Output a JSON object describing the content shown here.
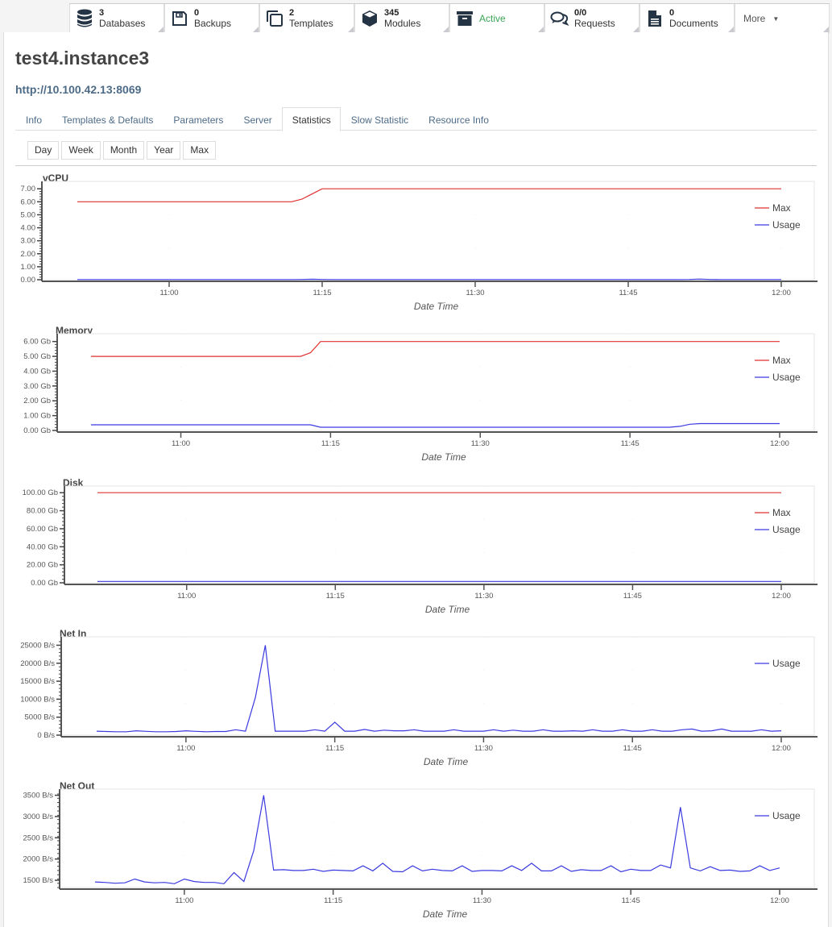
{
  "topbar": {
    "items": [
      {
        "icon": "database-icon",
        "count": "3",
        "label": "Databases"
      },
      {
        "icon": "floppy-disk-icon",
        "count": "0",
        "label": "Backups"
      },
      {
        "icon": "copy-icon",
        "count": "2",
        "label": "Templates"
      },
      {
        "icon": "cube-icon",
        "count": "345",
        "label": "Modules"
      },
      {
        "icon": "archive-icon",
        "status": "Active",
        "status_color": "#3aa655"
      },
      {
        "icon": "comments-icon",
        "count": "0/0",
        "label": "Requests"
      },
      {
        "icon": "file-icon",
        "count": "0",
        "label": "Documents"
      }
    ],
    "more_label": "More"
  },
  "instance": {
    "title": "test4.instance3",
    "url": "http://10.100.42.13:8069"
  },
  "tabs": [
    {
      "label": "Info"
    },
    {
      "label": "Templates & Defaults"
    },
    {
      "label": "Parameters"
    },
    {
      "label": "Server"
    },
    {
      "label": "Statistics",
      "active": true
    },
    {
      "label": "Slow Statistic"
    },
    {
      "label": "Resource Info"
    }
  ],
  "periods": [
    "Day",
    "Week",
    "Month",
    "Year",
    "Max"
  ],
  "colors": {
    "max": "#e03030",
    "usage": "#3a3ae0"
  },
  "chart_data": [
    {
      "type": "line",
      "title": "vCPU",
      "xlabel": "Date Time",
      "ylabel": "",
      "x_start": "10:51",
      "x_end": "12:00",
      "x_step_minutes": 1,
      "xticks": [
        "11:00",
        "11:15",
        "11:30",
        "11:45",
        "12:00"
      ],
      "yticks": [
        "0.00",
        "1.00",
        "2.00",
        "3.00",
        "4.00",
        "5.00",
        "6.00",
        "7.00"
      ],
      "ylim": [
        0,
        7.2
      ],
      "legend": "top-right",
      "series": [
        {
          "name": "Max",
          "color_key": "max",
          "values": [
            6,
            6,
            6,
            6,
            6,
            6,
            6,
            6,
            6,
            6,
            6,
            6,
            6,
            6,
            6,
            6,
            6,
            6,
            6,
            6,
            6,
            6,
            6.2,
            6.6,
            7,
            7,
            7,
            7,
            7,
            7,
            7,
            7,
            7,
            7,
            7,
            7,
            7,
            7,
            7,
            7,
            7,
            7,
            7,
            7,
            7,
            7,
            7,
            7,
            7,
            7,
            7,
            7,
            7,
            7,
            7,
            7,
            7,
            7,
            7,
            7,
            7,
            7,
            7,
            7,
            7,
            7,
            7,
            7,
            7,
            7
          ]
        },
        {
          "name": "Usage",
          "color_key": "usage",
          "values": [
            0.01,
            0.01,
            0.01,
            0.01,
            0.01,
            0.01,
            0.01,
            0.01,
            0.01,
            0.01,
            0.01,
            0.01,
            0.01,
            0.01,
            0.01,
            0.01,
            0.01,
            0.01,
            0.01,
            0.01,
            0.01,
            0.01,
            0.02,
            0.04,
            0.02,
            0.01,
            0.01,
            0.01,
            0.01,
            0.01,
            0.01,
            0.01,
            0.01,
            0.01,
            0.01,
            0.01,
            0.01,
            0.01,
            0.01,
            0.01,
            0.01,
            0.01,
            0.01,
            0.01,
            0.01,
            0.01,
            0.01,
            0.01,
            0.01,
            0.01,
            0.01,
            0.01,
            0.01,
            0.01,
            0.01,
            0.01,
            0.01,
            0.01,
            0.01,
            0.01,
            0.02,
            0.05,
            0.02,
            0.01,
            0.01,
            0.01,
            0.01,
            0.01,
            0.01,
            0.01
          ]
        }
      ]
    },
    {
      "type": "line",
      "title": "Memory",
      "xlabel": "Date Time",
      "ylabel": "",
      "x_start": "10:51",
      "x_end": "12:00",
      "x_step_minutes": 1,
      "xticks": [
        "11:00",
        "11:15",
        "11:30",
        "11:45",
        "12:00"
      ],
      "yticks": [
        "0.00 Gb",
        "1.00 Gb",
        "2.00 Gb",
        "3.00 Gb",
        "4.00 Gb",
        "5.00 Gb",
        "6.00 Gb"
      ],
      "ylim": [
        0,
        6.2
      ],
      "legend": "top-right",
      "series": [
        {
          "name": "Max",
          "color_key": "max",
          "values": [
            5,
            5,
            5,
            5,
            5,
            5,
            5,
            5,
            5,
            5,
            5,
            5,
            5,
            5,
            5,
            5,
            5,
            5,
            5,
            5,
            5,
            5,
            5.25,
            6,
            6,
            6,
            6,
            6,
            6,
            6,
            6,
            6,
            6,
            6,
            6,
            6,
            6,
            6,
            6,
            6,
            6,
            6,
            6,
            6,
            6,
            6,
            6,
            6,
            6,
            6,
            6,
            6,
            6,
            6,
            6,
            6,
            6,
            6,
            6,
            6,
            6,
            6,
            6,
            6,
            6,
            6,
            6,
            6,
            6,
            6
          ]
        },
        {
          "name": "Usage",
          "color_key": "usage",
          "values": [
            0.38,
            0.38,
            0.38,
            0.38,
            0.38,
            0.38,
            0.38,
            0.38,
            0.38,
            0.38,
            0.38,
            0.38,
            0.38,
            0.38,
            0.38,
            0.38,
            0.38,
            0.38,
            0.38,
            0.38,
            0.38,
            0.38,
            0.38,
            0.22,
            0.22,
            0.22,
            0.22,
            0.22,
            0.22,
            0.22,
            0.22,
            0.22,
            0.22,
            0.22,
            0.22,
            0.22,
            0.22,
            0.22,
            0.22,
            0.22,
            0.22,
            0.22,
            0.22,
            0.22,
            0.22,
            0.22,
            0.22,
            0.22,
            0.22,
            0.22,
            0.22,
            0.22,
            0.22,
            0.22,
            0.22,
            0.22,
            0.22,
            0.22,
            0.22,
            0.28,
            0.42,
            0.46,
            0.46,
            0.46,
            0.46,
            0.46,
            0.46,
            0.46,
            0.46,
            0.46
          ]
        }
      ]
    },
    {
      "type": "line",
      "title": "Disk",
      "xlabel": "Date Time",
      "ylabel": "",
      "x_start": "10:51",
      "x_end": "12:00",
      "x_step_minutes": 1,
      "xticks": [
        "11:00",
        "11:15",
        "11:30",
        "11:45",
        "12:00"
      ],
      "yticks": [
        "0.00 Gb",
        "20.00 Gb",
        "40.00 Gb",
        "60.00 Gb",
        "80.00 Gb",
        "100.00 Gb"
      ],
      "ylim": [
        0,
        102
      ],
      "legend": "top-right",
      "series": [
        {
          "name": "Max",
          "color_key": "max",
          "values": [
            100,
            100,
            100,
            100,
            100,
            100,
            100,
            100,
            100,
            100,
            100,
            100,
            100,
            100,
            100,
            100,
            100,
            100,
            100,
            100,
            100,
            100,
            100,
            100,
            100,
            100,
            100,
            100,
            100,
            100,
            100,
            100,
            100,
            100,
            100,
            100,
            100,
            100,
            100,
            100,
            100,
            100,
            100,
            100,
            100,
            100,
            100,
            100,
            100,
            100,
            100,
            100,
            100,
            100,
            100,
            100,
            100,
            100,
            100,
            100,
            100,
            100,
            100,
            100,
            100,
            100,
            100,
            100,
            100,
            100
          ]
        },
        {
          "name": "Usage",
          "color_key": "usage",
          "values": [
            1.5,
            1.5,
            1.5,
            1.5,
            1.5,
            1.5,
            1.5,
            1.5,
            1.5,
            1.5,
            1.5,
            1.5,
            1.5,
            1.5,
            1.5,
            1.5,
            1.5,
            1.5,
            1.5,
            1.5,
            1.5,
            1.5,
            1.5,
            1.5,
            1.5,
            1.5,
            1.5,
            1.5,
            1.5,
            1.5,
            1.5,
            1.5,
            1.5,
            1.5,
            1.5,
            1.5,
            1.5,
            1.5,
            1.5,
            1.5,
            1.5,
            1.5,
            1.5,
            1.5,
            1.5,
            1.5,
            1.5,
            1.5,
            1.5,
            1.5,
            1.5,
            1.5,
            1.5,
            1.5,
            1.5,
            1.5,
            1.5,
            1.5,
            1.5,
            1.5,
            1.5,
            1.5,
            1.5,
            1.5,
            1.5,
            1.5,
            1.5,
            1.5,
            1.5,
            1.5
          ]
        }
      ]
    },
    {
      "type": "line",
      "title": "Net In",
      "xlabel": "Date Time",
      "ylabel": "",
      "x_start": "10:51",
      "x_end": "12:00",
      "x_step_minutes": 1,
      "xticks": [
        "11:00",
        "11:15",
        "11:30",
        "11:45",
        "12:00"
      ],
      "yticks": [
        "0 B/s",
        "5000 B/s",
        "10000 B/s",
        "15000 B/s",
        "20000 B/s",
        "25000 B/s"
      ],
      "ylim": [
        0,
        26000
      ],
      "legend": "top-right",
      "series": [
        {
          "name": "Usage",
          "color_key": "usage",
          "values": [
            1100,
            1000,
            950,
            950,
            1200,
            1050,
            950,
            950,
            1000,
            1200,
            1050,
            950,
            1000,
            1000,
            1500,
            1100,
            10500,
            25000,
            1100,
            1100,
            1100,
            1100,
            1500,
            1100,
            3600,
            1100,
            1100,
            1600,
            1100,
            1400,
            1200,
            1200,
            1500,
            1100,
            1100,
            1100,
            1500,
            1100,
            1100,
            1100,
            1500,
            1100,
            1400,
            1100,
            1100,
            1500,
            1100,
            1100,
            1200,
            1100,
            1500,
            1100,
            1100,
            1500,
            1100,
            1100,
            1500,
            1100,
            1100,
            1500,
            1700,
            1100,
            1200,
            1700,
            1100,
            1100,
            1100,
            1500,
            1100,
            1200
          ]
        }
      ]
    },
    {
      "type": "line",
      "title": "Net Out",
      "xlabel": "Date Time",
      "ylabel": "",
      "x_start": "10:51",
      "x_end": "12:00",
      "x_step_minutes": 1,
      "xticks": [
        "11:00",
        "11:15",
        "11:30",
        "11:45",
        "12:00"
      ],
      "yticks": [
        "1500 B/s",
        "2000 B/s",
        "2500 B/s",
        "3000 B/s",
        "3500 B/s"
      ],
      "ylim": [
        1330,
        3530
      ],
      "legend": "top-right",
      "series": [
        {
          "name": "Usage",
          "color_key": "usage",
          "values": [
            1460,
            1450,
            1430,
            1440,
            1530,
            1460,
            1440,
            1450,
            1420,
            1530,
            1470,
            1450,
            1450,
            1420,
            1680,
            1470,
            2200,
            3500,
            1740,
            1750,
            1730,
            1730,
            1760,
            1710,
            1740,
            1730,
            1720,
            1840,
            1720,
            1900,
            1710,
            1700,
            1840,
            1720,
            1760,
            1730,
            1720,
            1840,
            1710,
            1730,
            1730,
            1720,
            1840,
            1730,
            1900,
            1720,
            1720,
            1840,
            1710,
            1750,
            1730,
            1730,
            1840,
            1700,
            1760,
            1730,
            1730,
            1860,
            1790,
            3220,
            1790,
            1720,
            1820,
            1730,
            1740,
            1710,
            1720,
            1840,
            1730,
            1790
          ]
        }
      ]
    }
  ]
}
